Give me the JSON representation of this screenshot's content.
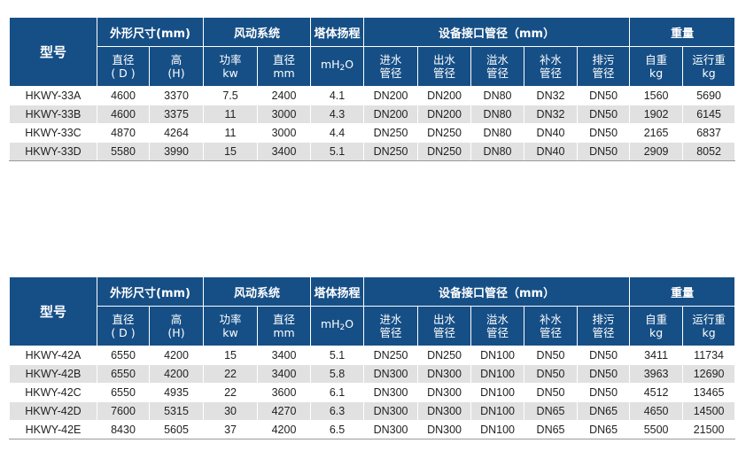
{
  "header_groups": {
    "model": "型号",
    "dimensions": "外形尺寸(mm)",
    "fan_system": "风动系统",
    "tower_head": "塔体扬程",
    "pipe_diameter": "设备接口管径（mm）",
    "weight": "重量"
  },
  "sub_headers": {
    "diameter": [
      "直径",
      "( D )"
    ],
    "height": [
      "高",
      "(H)"
    ],
    "power": [
      "功率",
      "kw"
    ],
    "fan_diameter": [
      "直径",
      "mm"
    ],
    "head_unit": [
      "mH",
      "2",
      "O"
    ],
    "inlet": [
      "进水",
      "管径"
    ],
    "outlet": [
      "出水",
      "管径"
    ],
    "overflow": [
      "溢水",
      "管径"
    ],
    "makeup": [
      "补水",
      "管径"
    ],
    "drain": [
      "排污",
      "管径"
    ],
    "self_weight": [
      "自重",
      "kg"
    ],
    "operating_weight": [
      "运行重",
      "kg"
    ]
  },
  "tables": [
    {
      "rows": [
        [
          "HKWY-33A",
          "4600",
          "3370",
          "7.5",
          "2400",
          "4.1",
          "DN200",
          "DN200",
          "DN80",
          "DN32",
          "DN50",
          "1560",
          "5690"
        ],
        [
          "HKWY-33B",
          "4600",
          "3375",
          "11",
          "3000",
          "4.3",
          "DN200",
          "DN200",
          "DN80",
          "DN32",
          "DN50",
          "1902",
          "6145"
        ],
        [
          "HKWY-33C",
          "4870",
          "4264",
          "11",
          "3000",
          "4.4",
          "DN250",
          "DN250",
          "DN80",
          "DN40",
          "DN50",
          "2165",
          "6837"
        ],
        [
          "HKWY-33D",
          "5580",
          "3990",
          "15",
          "3400",
          "5.1",
          "DN250",
          "DN250",
          "DN80",
          "DN40",
          "DN50",
          "2909",
          "8052"
        ]
      ]
    },
    {
      "rows": [
        [
          "HKWY-42A",
          "6550",
          "4200",
          "15",
          "3400",
          "5.1",
          "DN250",
          "DN250",
          "DN100",
          "DN50",
          "DN50",
          "3411",
          "11734"
        ],
        [
          "HKWY-42B",
          "6550",
          "4200",
          "22",
          "3400",
          "5.8",
          "DN300",
          "DN300",
          "DN100",
          "DN50",
          "DN50",
          "3963",
          "12690"
        ],
        [
          "HKWY-42C",
          "6550",
          "4935",
          "22",
          "3600",
          "6.1",
          "DN300",
          "DN300",
          "DN100",
          "DN50",
          "DN50",
          "4512",
          "13465"
        ],
        [
          "HKWY-42D",
          "7600",
          "5315",
          "30",
          "4270",
          "6.3",
          "DN300",
          "DN300",
          "DN100",
          "DN65",
          "DN65",
          "4650",
          "14500"
        ],
        [
          "HKWY-42E",
          "8430",
          "5605",
          "37",
          "4200",
          "6.5",
          "DN300",
          "DN300",
          "DN100",
          "DN65",
          "DN65",
          "5500",
          "21500"
        ]
      ]
    }
  ],
  "colors": {
    "header_bg": "#164f86",
    "header_text": "#ffffff",
    "row_alt_bg": "#e1e1e1"
  }
}
